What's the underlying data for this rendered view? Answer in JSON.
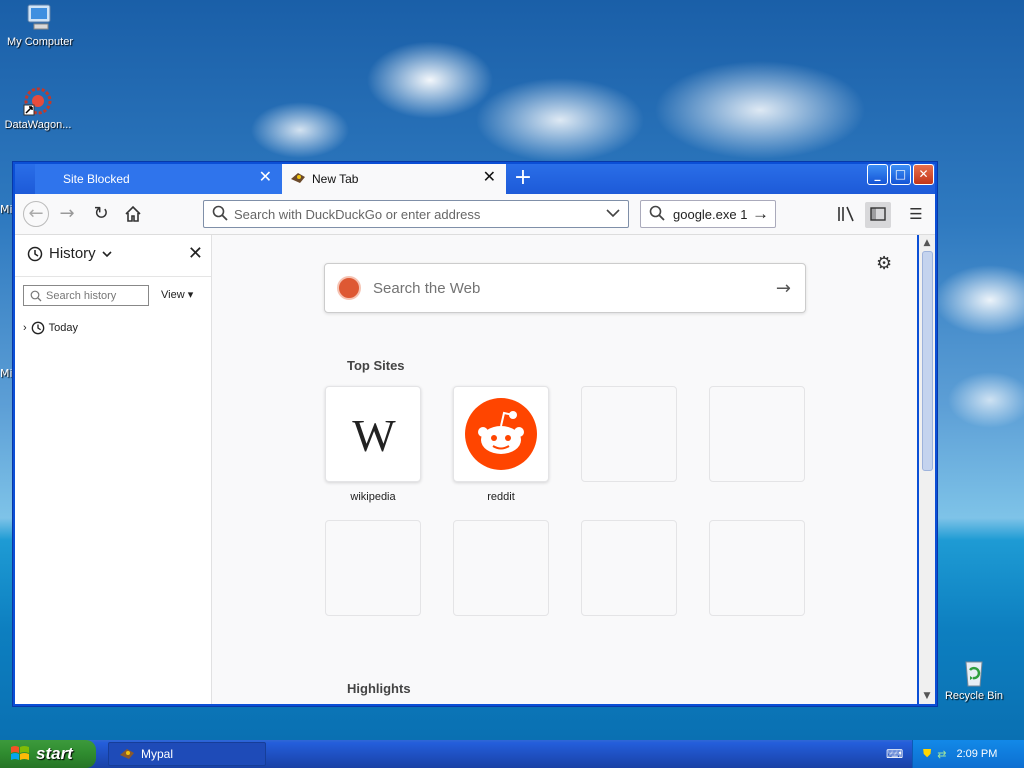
{
  "desktop": {
    "icons": [
      {
        "label": "My Computer"
      },
      {
        "label": "DataWagon..."
      },
      {
        "label": "Recycle Bin"
      }
    ],
    "edge_labels": [
      "Mi",
      "Mi"
    ]
  },
  "browser": {
    "tabs": [
      {
        "label": "Site Blocked",
        "active": false
      },
      {
        "label": "New Tab",
        "active": true
      }
    ],
    "urlbar": {
      "placeholder": "Search with DuckDuckGo or enter address"
    },
    "searchbar": {
      "value": "google.exe 1"
    },
    "sidebar": {
      "title": "History",
      "search_placeholder": "Search history",
      "view_label": "View",
      "groups": [
        {
          "label": "Today"
        }
      ]
    },
    "newtab": {
      "web_search_placeholder": "Search the Web",
      "top_sites_title": "Top Sites",
      "top_sites": [
        {
          "label": "wikipedia",
          "icon": "wikipedia-logo"
        },
        {
          "label": "reddit",
          "icon": "reddit-logo"
        },
        {
          "label": ""
        },
        {
          "label": ""
        },
        {
          "label": ""
        },
        {
          "label": ""
        },
        {
          "label": ""
        },
        {
          "label": ""
        }
      ],
      "highlights_title": "Highlights"
    }
  },
  "taskbar": {
    "start_label": "start",
    "tasks": [
      {
        "label": "Mypal"
      }
    ],
    "clock": "2:09 PM"
  },
  "colors": {
    "titlebar": "#0b4fd6",
    "reddit": "#ff4500",
    "duckduckgo": "#de5833",
    "start_green": "#3c9a3c"
  }
}
